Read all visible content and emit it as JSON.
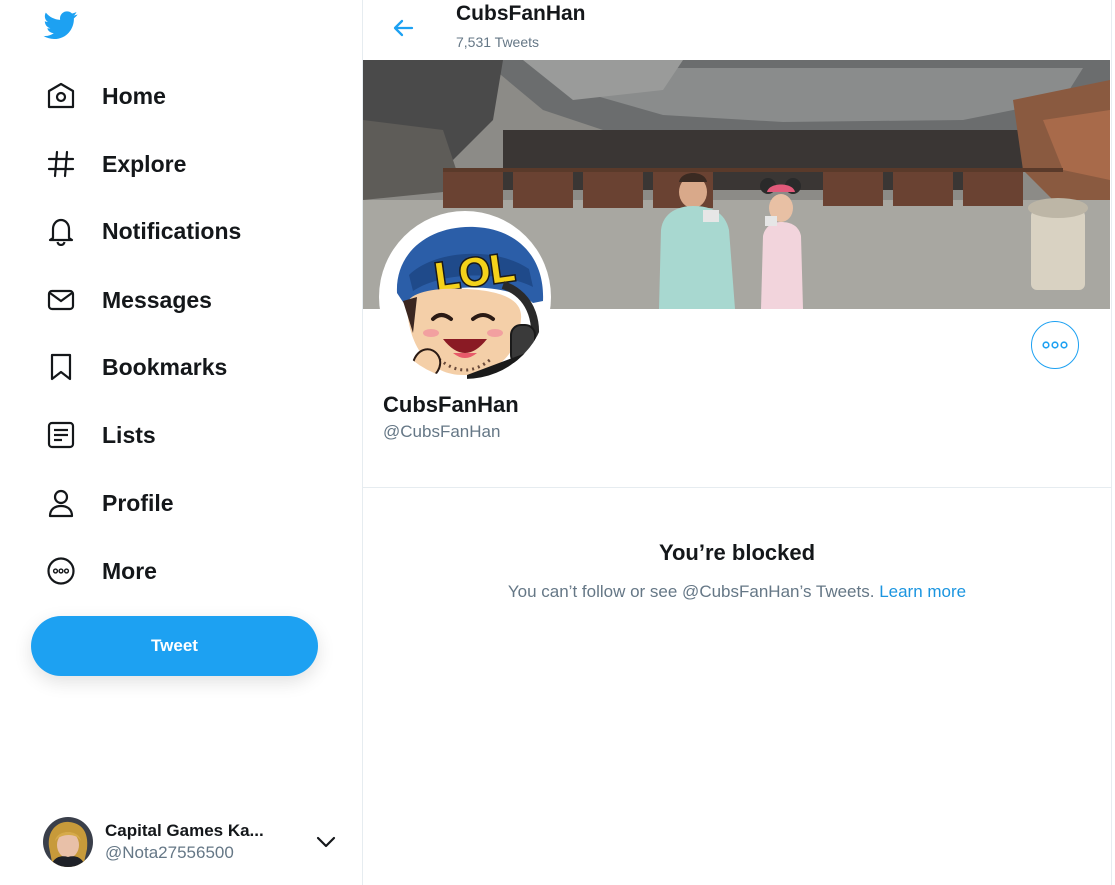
{
  "nav": {
    "items": [
      {
        "label": "Home",
        "icon": "home-icon"
      },
      {
        "label": "Explore",
        "icon": "hashtag-icon"
      },
      {
        "label": "Notifications",
        "icon": "bell-icon"
      },
      {
        "label": "Messages",
        "icon": "envelope-icon"
      },
      {
        "label": "Bookmarks",
        "icon": "bookmark-icon"
      },
      {
        "label": "Lists",
        "icon": "list-icon"
      },
      {
        "label": "Profile",
        "icon": "person-icon"
      },
      {
        "label": "More",
        "icon": "more-circle-icon"
      }
    ],
    "tweet_label": "Tweet"
  },
  "account": {
    "name": "Capital Games Ka...",
    "handle": "@Nota27556500"
  },
  "header": {
    "title": "CubsFanHan",
    "tweet_count": "7,531 Tweets"
  },
  "profile": {
    "name": "CubsFanHan",
    "handle": "@CubsFanHan",
    "avatar_text": "LOL"
  },
  "blocked": {
    "title": "You’re blocked",
    "message": "You can’t follow or see @CubsFanHan’s Tweets.",
    "link": "Learn more"
  },
  "colors": {
    "accent": "#1da1f2",
    "link": "#1b95e0",
    "text": "#14171a",
    "secondary": "#657786"
  }
}
